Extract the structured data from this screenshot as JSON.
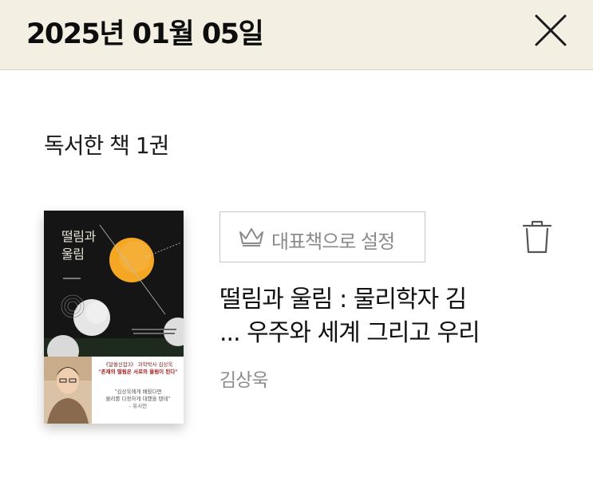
{
  "header": {
    "date": "2025년 01월 05일",
    "close_icon": "close-icon"
  },
  "summary": {
    "count_label": "독서한 책 1권"
  },
  "book": {
    "cover_icon": "book-cover-image",
    "cover_title_line1": "떨림과",
    "cover_title_line2": "울림",
    "cover_band_top": "《알쓸신잡3》 과학박사 김상욱",
    "cover_band_headline": "\"존재의 떨림은 서로의 울림이 된다\"",
    "cover_band_quote1": "\"김상욱에게 배웠다면",
    "cover_band_quote2": "물리를 다정하게 대했을 텐데\"",
    "cover_band_quote3": "- 유시민",
    "representative_label": "대표책으로 설정",
    "crown_icon": "crown-icon",
    "trash_icon": "trash-icon",
    "title_line1": "떨림과 울림 : 물리학자 김",
    "title_line2": "... 우주와 세계 그리고 우리",
    "author": "김상욱"
  },
  "colors": {
    "header_bg": "#f3f0e3",
    "cover_ball": "#f5a623",
    "muted_text": "#8c8c8c"
  }
}
